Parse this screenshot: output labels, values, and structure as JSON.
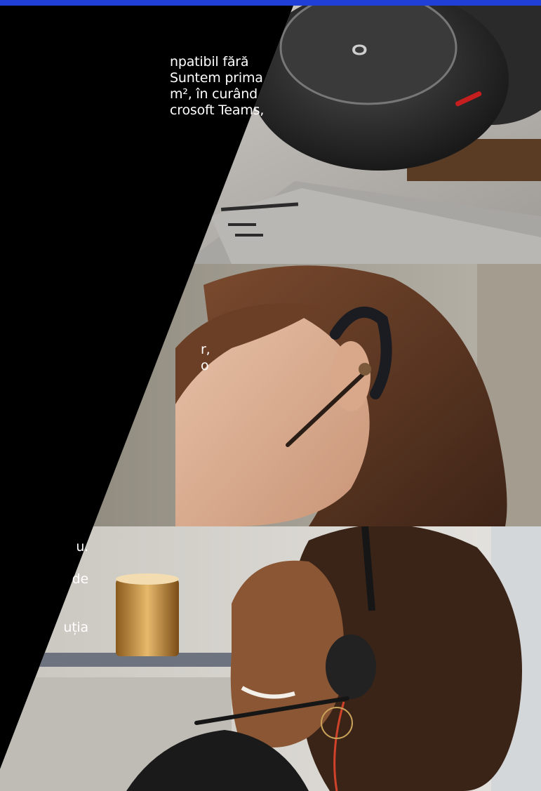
{
  "text_block_1": {
    "lines": [
      "npatibil fără",
      "Suntem prima",
      "m², în curând",
      "crosoft Teams,"
    ]
  },
  "text_block_2": {
    "lines": [
      "r,",
      "o"
    ]
  },
  "text_block_3": {
    "lines": [
      "u.",
      "",
      "de",
      "",
      "",
      "uția"
    ]
  },
  "photos": [
    {
      "subject": "headset-earcup-closeup"
    },
    {
      "subject": "woman-with-earpiece-headset"
    },
    {
      "subject": "woman-with-boom-headset"
    }
  ],
  "colors": {
    "top_bar": "#1f3fd6",
    "panel": "#000000"
  }
}
